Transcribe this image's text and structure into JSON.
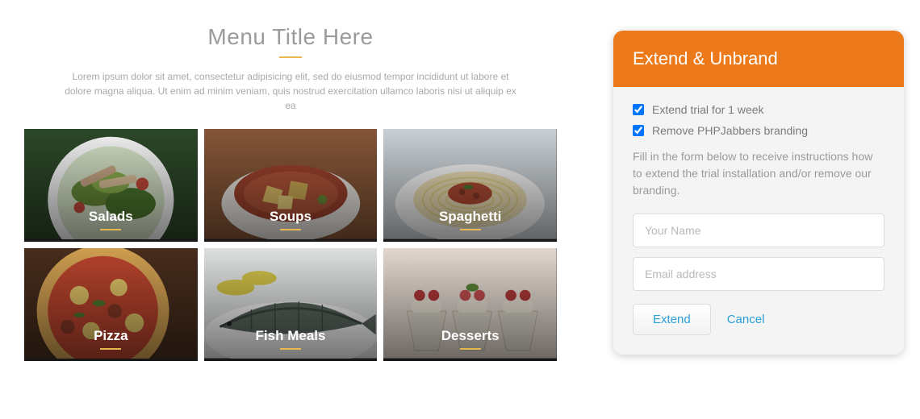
{
  "menu": {
    "title": "Menu Title Here",
    "description": "Lorem ipsum dolor sit amet, consectetur adipisicing elit, sed do eiusmod tempor incididunt ut labore et dolore magna aliqua. Ut enim ad minim veniam, quis nostrud exercitation ullamco laboris nisi ut aliquip ex ea",
    "tiles": [
      {
        "label": "Salads"
      },
      {
        "label": "Soups"
      },
      {
        "label": "Spaghetti"
      },
      {
        "label": "Pizza"
      },
      {
        "label": "Fish Meals"
      },
      {
        "label": "Desserts"
      }
    ]
  },
  "panel": {
    "title": "Extend & Unbrand",
    "chk_extend_label": "Extend trial for 1 week",
    "chk_remove_label": "Remove PHPJabbers branding",
    "text": "Fill in the form below to receive instructions how to extend the trial installation and/or remove our branding.",
    "name_placeholder": "Your Name",
    "email_placeholder": "Email address",
    "btn_extend": "Extend",
    "link_cancel": "Cancel",
    "chk_extend_checked": true,
    "chk_remove_checked": true
  }
}
